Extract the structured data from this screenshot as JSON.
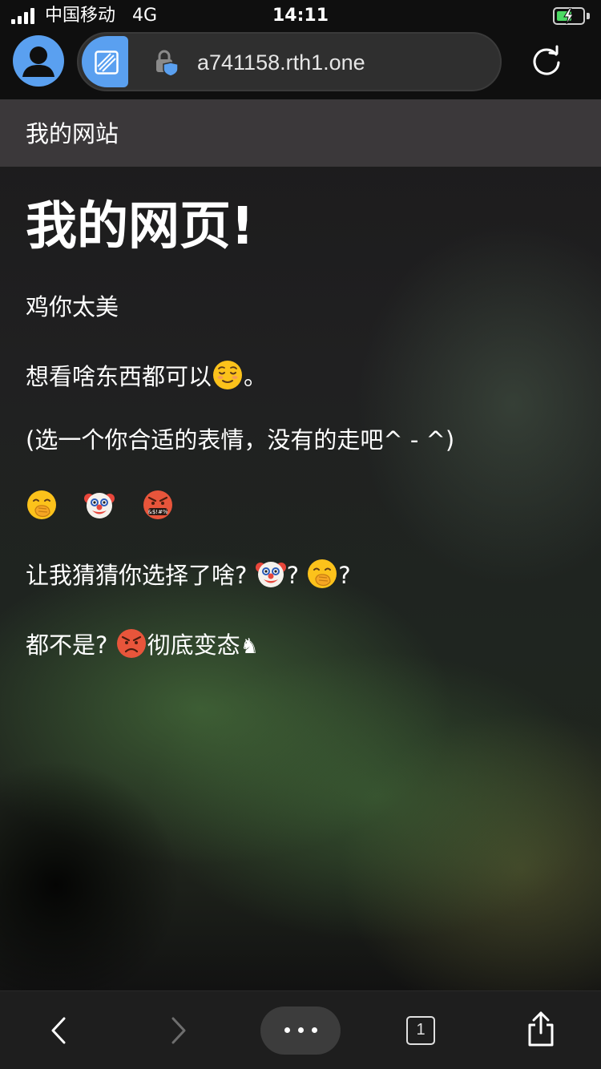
{
  "status_bar": {
    "carrier": "中国移动",
    "network": "4G",
    "time": "14:11",
    "battery_charging": true,
    "battery_color": "#4cd964"
  },
  "browser": {
    "url": "a741158.rth1.one",
    "accent_color": "#5aa0f0",
    "icons": [
      "avatar-icon",
      "tab-thumbnail-icon",
      "lock-shield-icon",
      "reload-icon"
    ]
  },
  "site": {
    "title": "我的网站"
  },
  "content": {
    "heading": "我的网页!",
    "line1": "鸡你太美",
    "line2_text": "想看啥东西都可以",
    "line2_end": "。",
    "line3": "(选一个你合适的表情，没有的走吧^ - ^)",
    "line5_text": "让我猜猜你选择了啥?",
    "line5_q1": "?",
    "line5_q2": "?",
    "line6_text": "都不是?",
    "line6_end": "彻底变态",
    "line6_glyph": "♞",
    "emoji_names": [
      "relieved-face",
      "face-with-hand-over-mouth",
      "clown-face",
      "face-with-symbols-on-mouth"
    ]
  },
  "bottom_bar": {
    "tab_count": "1",
    "icons": [
      "back-icon",
      "forward-icon",
      "more-icon",
      "tabs-icon",
      "share-icon"
    ]
  }
}
